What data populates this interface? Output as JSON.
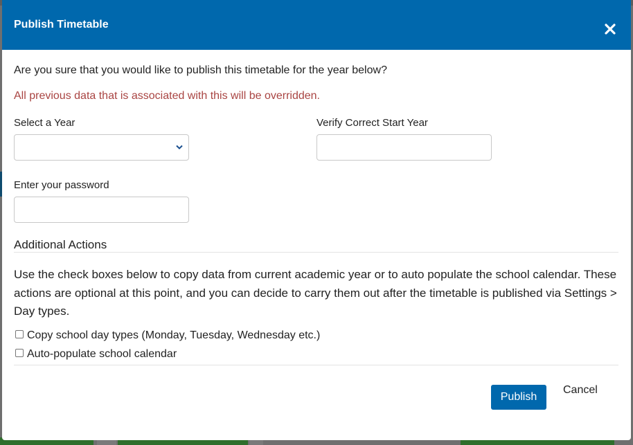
{
  "modal": {
    "title": "Publish Timetable",
    "close_icon": "close-icon",
    "question": "Are you sure that you would like to publish this timetable for the year below?",
    "warning": "All previous data that is associated with this will be overridden.",
    "warning_color": "#a94442",
    "header_color": "#0068ad",
    "year_select": {
      "label": "Select a Year",
      "value": ""
    },
    "verify_year": {
      "label": "Verify Correct Start Year",
      "value": ""
    },
    "password": {
      "label": "Enter your password",
      "value": ""
    },
    "additional_actions": {
      "title": "Additional Actions",
      "description": "Use the check boxes below to copy data from current academic year or to auto populate the school calendar. These actions are optional at this point, and you can decide to carry them out after the timetable is published via Settings > Day types.",
      "options": [
        {
          "label": "Copy school day types (Monday, Tuesday, Wednesday etc.)",
          "checked": false
        },
        {
          "label": "Auto-populate school calendar",
          "checked": false
        }
      ]
    },
    "buttons": {
      "publish": "Publish",
      "cancel": "Cancel"
    }
  }
}
